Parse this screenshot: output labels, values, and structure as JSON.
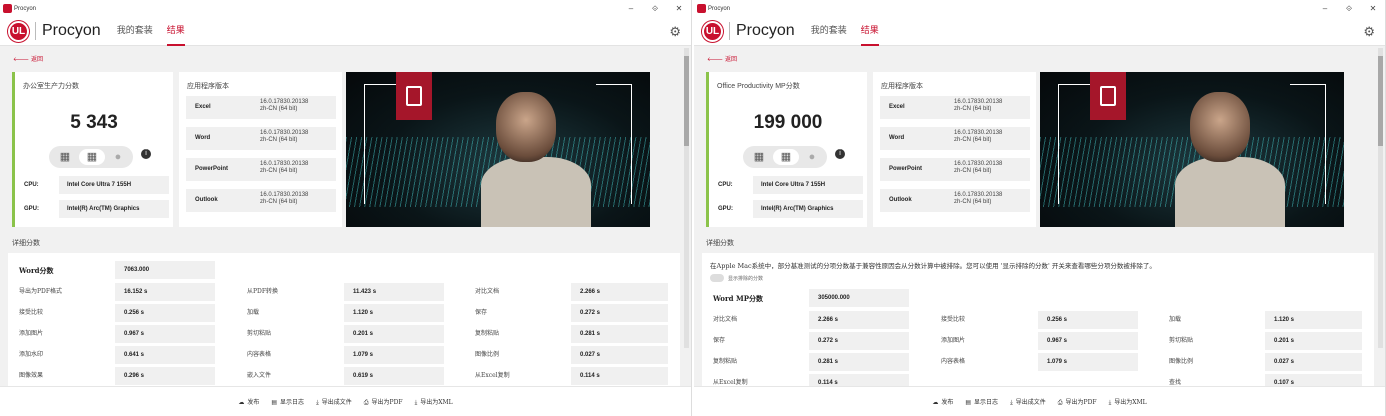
{
  "app_title": "Procyon",
  "brand": "Procyon",
  "ul_logo": "UL",
  "nav": [
    "我的套装",
    "结果"
  ],
  "back": "返回",
  "accent": "#c8102e",
  "score_bar_color": "#8bc34a",
  "controls": [
    "–",
    "⟐",
    "✕"
  ],
  "left": {
    "score_label": "办公室生产力分数",
    "score": "5 343",
    "cpu_label": "CPU:",
    "cpu": "Intel Core Ultra 7 155H",
    "gpu_label": "GPU:",
    "gpu": "Intel(R) Arc(TM) Graphics",
    "apps_label": "应用程序版本",
    "apps": [
      {
        "name": "Excel",
        "v1": "16.0.17830.20138",
        "v2": "zh-CN (64 bit)"
      },
      {
        "name": "Word",
        "v1": "16.0.17830.20138",
        "v2": "zh-CN (64 bit)"
      },
      {
        "name": "PowerPoint",
        "v1": "16.0.17830.20138",
        "v2": "zh-CN (64 bit)"
      },
      {
        "name": "Outlook",
        "v1": "16.0.17830.20138",
        "v2": "zh-CN (64 bit)"
      }
    ],
    "detail_label": "详细分数",
    "word_label": "Word分数",
    "word_value": "7063.000",
    "rows": [
      [
        "导出为PDF格式",
        "16.152 s",
        "从PDF转换",
        "11.423 s",
        "对比文档",
        "2.266 s"
      ],
      [
        "接受比较",
        "0.256 s",
        "加载",
        "1.120 s",
        "保存",
        "0.272 s"
      ],
      [
        "添加图片",
        "0.967 s",
        "剪切粘贴",
        "0.201 s",
        "复制粘贴",
        "0.281 s"
      ],
      [
        "添加水印",
        "0.641 s",
        "内容表格",
        "1.079 s",
        "图像比例",
        "0.027 s"
      ],
      [
        "图像效果",
        "0.296 s",
        "嵌入文件",
        "0.619 s",
        "从Excel复制",
        "0.114 s"
      ]
    ]
  },
  "right": {
    "score_label": "Office Productivity MP分数",
    "score": "199 000",
    "cpu_label": "CPU:",
    "cpu": "Intel Core Ultra 7 155H",
    "gpu_label": "GPU:",
    "gpu": "Intel(R) Arc(TM) Graphics",
    "apps_label": "应用程序版本",
    "apps": [
      {
        "name": "Excel",
        "v1": "16.0.17830.20138",
        "v2": "zh-CN (64 bit)"
      },
      {
        "name": "Word",
        "v1": "16.0.17830.20138",
        "v2": "zh-CN (64 bit)"
      },
      {
        "name": "PowerPoint",
        "v1": "16.0.17830.20138",
        "v2": "zh-CN (64 bit)"
      },
      {
        "name": "Outlook",
        "v1": "16.0.17830.20138",
        "v2": "zh-CN (64 bit)"
      }
    ],
    "detail_label": "详细分数",
    "note": "在Apple Mac系统中，部分基准测试的分项分数基于兼容性原因会从分数计算中被排除。您可以使用 '显示排除的分数' 开关来查看哪些分项分数被排除了。",
    "toggle_label": "显示排除的分数",
    "word_label": "Word MP分数",
    "word_value": "305000.000",
    "rows": [
      [
        "对比文档",
        "2.266 s",
        "接受比较",
        "0.256 s",
        "加载",
        "1.120 s"
      ],
      [
        "保存",
        "0.272 s",
        "添加图片",
        "0.967 s",
        "剪切粘贴",
        "0.201 s"
      ],
      [
        "复制粘贴",
        "0.281 s",
        "内容表格",
        "1.079 s",
        "图像比例",
        "0.027 s"
      ],
      [
        "从Excel复制",
        "0.114 s",
        "",
        "",
        "查找",
        "0.107 s"
      ]
    ]
  },
  "footer": [
    {
      "icon": "☁",
      "label": "发布"
    },
    {
      "icon": "▤",
      "label": "显示日志"
    },
    {
      "icon": "⤓",
      "label": "导出成文件"
    },
    {
      "icon": "⎙",
      "label": "导出为PDF"
    },
    {
      "icon": "⤓",
      "label": "导出为XML"
    }
  ]
}
